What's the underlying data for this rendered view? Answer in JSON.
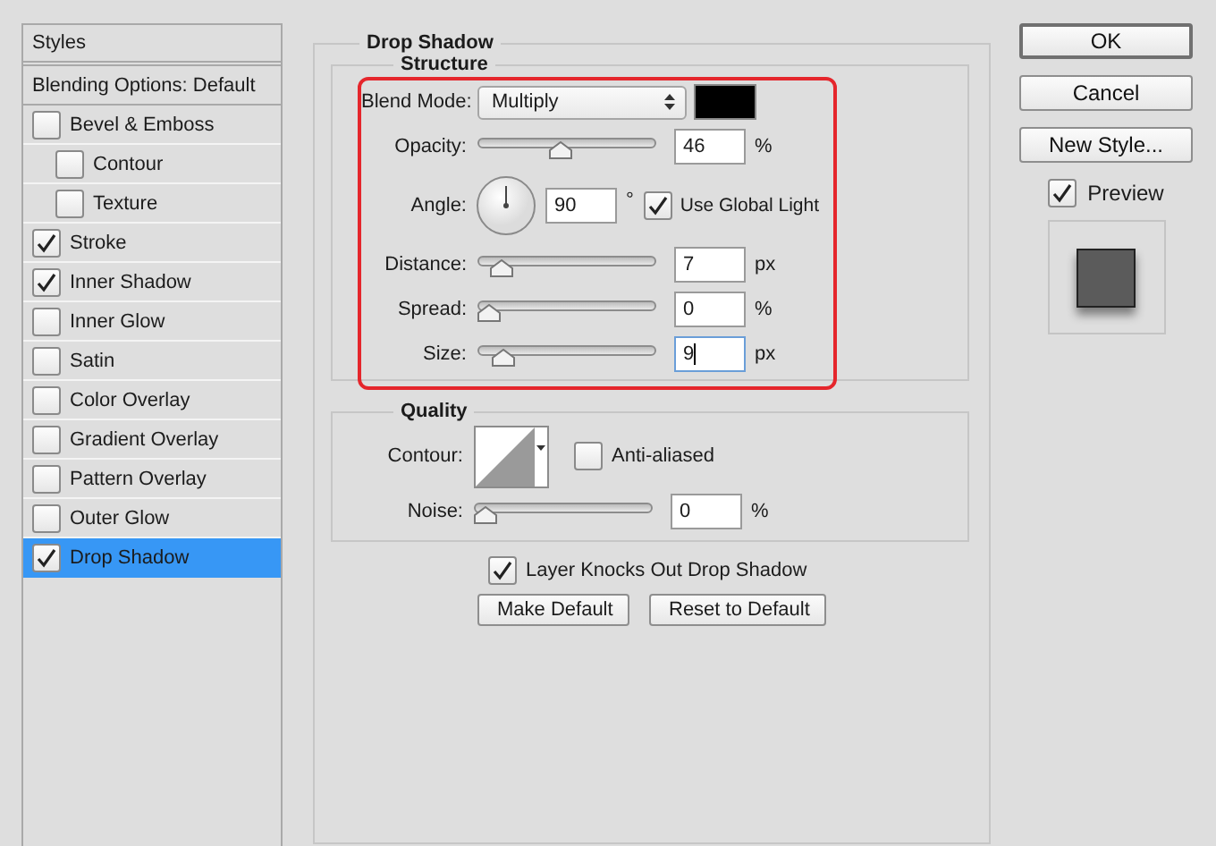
{
  "sidebar": {
    "header": "Styles",
    "items": [
      {
        "kind": "plain",
        "label": "Blending Options: Default",
        "selected": false
      },
      {
        "kind": "check",
        "label": "Bevel & Emboss",
        "checked": false,
        "selected": false,
        "children": [
          {
            "kind": "check",
            "label": "Contour",
            "checked": false,
            "selected": false
          },
          {
            "kind": "check",
            "label": "Texture",
            "checked": false,
            "selected": false
          }
        ]
      },
      {
        "kind": "check",
        "label": "Stroke",
        "checked": true,
        "selected": false
      },
      {
        "kind": "check",
        "label": "Inner Shadow",
        "checked": true,
        "selected": false
      },
      {
        "kind": "check",
        "label": "Inner Glow",
        "checked": false,
        "selected": false
      },
      {
        "kind": "check",
        "label": "Satin",
        "checked": false,
        "selected": false
      },
      {
        "kind": "check",
        "label": "Color Overlay",
        "checked": false,
        "selected": false
      },
      {
        "kind": "check",
        "label": "Gradient Overlay",
        "checked": false,
        "selected": false
      },
      {
        "kind": "check",
        "label": "Pattern Overlay",
        "checked": false,
        "selected": false
      },
      {
        "kind": "check",
        "label": "Outer Glow",
        "checked": false,
        "selected": false
      },
      {
        "kind": "check",
        "label": "Drop Shadow",
        "checked": true,
        "selected": true
      }
    ]
  },
  "effect": {
    "title": "Drop Shadow",
    "structure": {
      "title": "Structure",
      "highlighted": true,
      "rows": [
        {
          "kind": "select",
          "label": "Blend Mode:",
          "value": "Multiply",
          "color": "#000000"
        },
        {
          "kind": "slider",
          "label": "Opacity:",
          "level": 0.46,
          "value": "46",
          "unit": "%",
          "focused": false
        },
        {
          "kind": "angle",
          "label": "Angle:",
          "value": "90",
          "unit": "°",
          "check": {
            "label": "Use Global Light",
            "checked": true
          }
        },
        {
          "kind": "slider",
          "label": "Distance:",
          "level": 0.08,
          "value": "7",
          "unit": "px",
          "focused": false
        },
        {
          "kind": "slider",
          "label": "Spread:",
          "level": 0,
          "value": "0",
          "unit": "%",
          "focused": false
        },
        {
          "kind": "slider",
          "label": "Size:",
          "level": 0.09,
          "value": "9",
          "unit": "px",
          "focused": true
        }
      ]
    },
    "quality": {
      "title": "Quality",
      "rows": [
        {
          "kind": "contour",
          "label": "Contour:",
          "check": {
            "label": "Anti-aliased",
            "checked": false
          }
        },
        {
          "kind": "slider",
          "label": "Noise:",
          "level": 0,
          "value": "0",
          "unit": "%",
          "focused": false
        }
      ]
    },
    "option": {
      "label": "Layer Knocks Out Drop Shadow",
      "checked": true
    },
    "buttons": [
      {
        "label": "Make Default"
      },
      {
        "label": "Reset to Default"
      }
    ]
  },
  "actions": {
    "buttons": [
      {
        "label": "OK",
        "default": true
      },
      {
        "label": "Cancel",
        "default": false
      },
      {
        "label": "New Style...",
        "default": false
      }
    ],
    "preview": {
      "label": "Preview",
      "checked": true
    }
  }
}
